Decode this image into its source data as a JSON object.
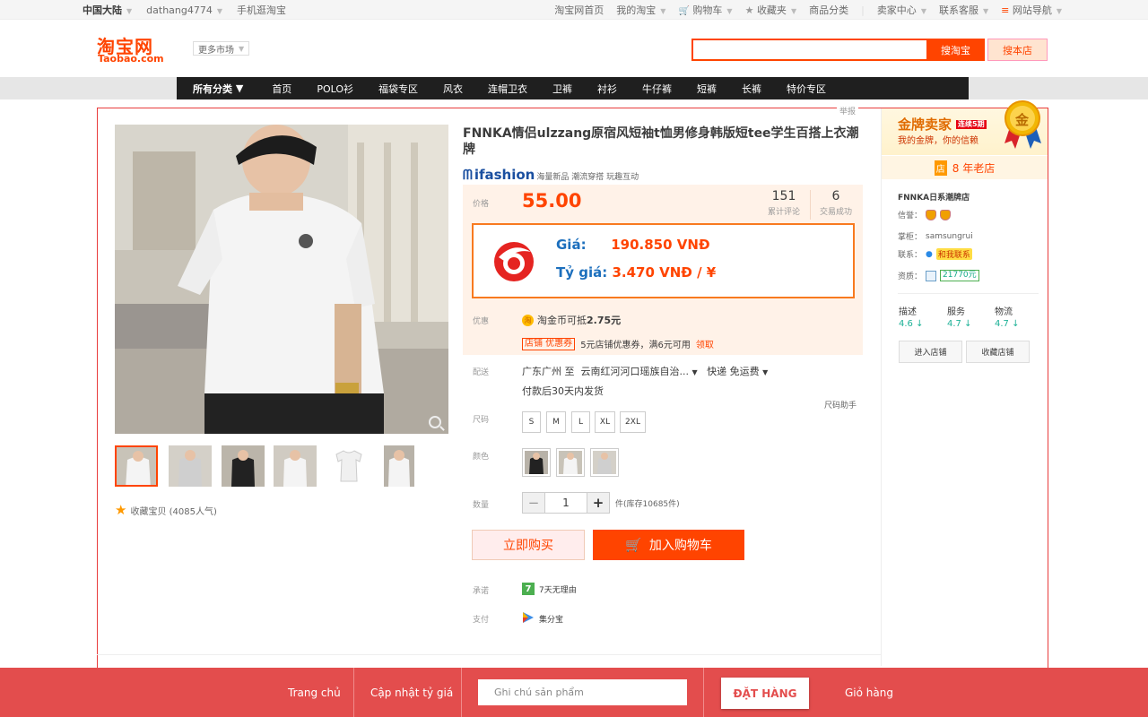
{
  "topbar": {
    "region": "中国大陆",
    "user": "dathang4774",
    "mobile": "手机逛淘宝",
    "links": [
      "淘宝网首页",
      "我的淘宝",
      "购物车",
      "收藏夹",
      "商品分类",
      "卖家中心",
      "联系客服",
      "网站导航"
    ]
  },
  "header": {
    "logo_cn": "淘宝网",
    "logo_en": "Taobao.com",
    "more_market": "更多市场",
    "search_placeholder": "",
    "search_btn": "搜淘宝",
    "search_store_btn": "搜本店"
  },
  "nav": {
    "all": "所有分类",
    "items": [
      "首页",
      "POLO衫",
      "福袋专区",
      "风衣",
      "连帽卫衣",
      "卫裤",
      "衬衫",
      "牛仔裤",
      "短裤",
      "长裤",
      "特价专区"
    ]
  },
  "product": {
    "report": "举报",
    "title": "FNNKA情侣ulzzang原宿风短袖t恤男修身韩版短tee学生百搭上衣潮牌",
    "ifashion": "ifashion",
    "ifashion_sub": "海量新品 潮流穿搭 玩趣互动",
    "price_label": "价格",
    "price": "55.00",
    "reviews": "151",
    "reviews_label": "累计评论",
    "deals": "6",
    "deals_label": "交易成功",
    "vnd_price_label": "Giá:",
    "vnd_price": "190.850 VNĐ",
    "rate_label": "Tỷ giá:",
    "rate": "3.470 VNĐ / ¥",
    "promo_label": "优惠",
    "promo_coin": "淘金币可抵",
    "promo_amount": "2.75元",
    "coupon_tag": "店铺 优惠券",
    "coupon_text": "5元店铺优惠券，满6元可用",
    "coupon_get": "领取",
    "ship_label": "配送",
    "ship_from": "广东广州 至",
    "ship_to": "云南红河河口瑶族自治...",
    "ship_method": "快递 免运费",
    "ship_time": "付款后30天内发货",
    "size_helper": "尺码助手",
    "size_label": "尺码",
    "sizes": [
      "S",
      "M",
      "L",
      "XL",
      "2XL"
    ],
    "color_label": "颜色",
    "qty_label": "数量",
    "qty_minus": "−",
    "qty": "1",
    "qty_plus": "+",
    "stock": "件(库存10685件)",
    "buy_now": "立即购买",
    "add_cart": "加入购物车",
    "promise_label": "承诺",
    "promise_badge": "7",
    "promise_text": "7天无理由",
    "pay_label": "支付",
    "pay_text": "集分宝",
    "fav": "收藏宝贝 (4085人气)"
  },
  "shop": {
    "gold_title": "金牌卖家",
    "gold_years": "连续5期",
    "gold_sub": "我的金牌，你的信赖",
    "medal": "金",
    "years_icon": "店",
    "years": "8 年老店",
    "name": "FNNKA日系潮牌店",
    "credit_label": "信誉：",
    "seller_label": "掌柜：",
    "seller": "samsungrui",
    "contact_label": "联系：",
    "contact": "和我联系",
    "deposit_label": "资质：",
    "deposit": "21770元",
    "ratings": [
      {
        "label": "描述",
        "value": "4.6 ↓"
      },
      {
        "label": "服务",
        "value": "4.7 ↓"
      },
      {
        "label": "物流",
        "value": "4.7 ↓"
      }
    ],
    "enter_btn": "进入店铺",
    "fav_btn": "收藏店铺"
  },
  "bottom": {
    "home": "Trang chủ",
    "update_rate": "Cập nhật tỷ giá",
    "note_placeholder": "Ghi chú sản phẩm",
    "order": "ĐẶT HÀNG",
    "cart": "Giỏ hàng"
  },
  "colors": {
    "taobao_orange": "#ff4400",
    "bottom_red": "#e34d4d",
    "vnd_blue": "#1c6fbd"
  }
}
